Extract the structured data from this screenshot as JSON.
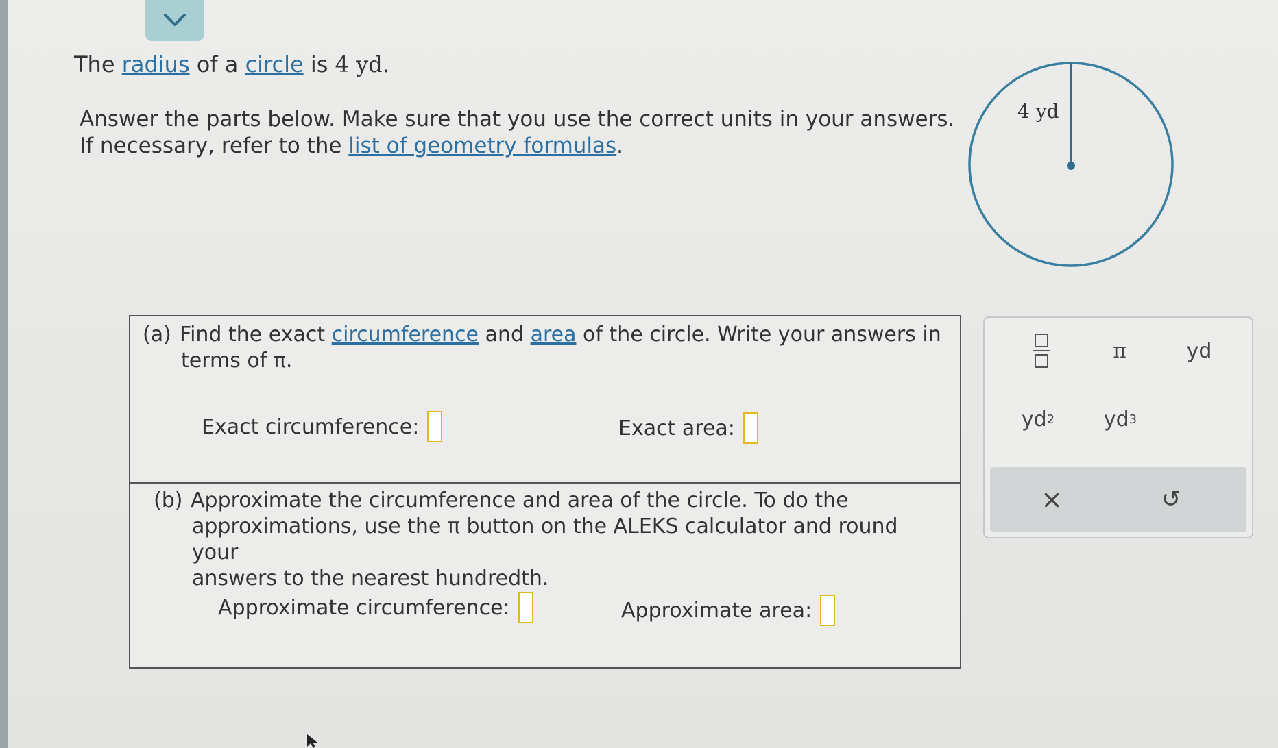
{
  "intro": {
    "prefix": "The",
    "radius_link": "radius",
    "of_a": "of a",
    "circle_link": "circle",
    "is": "is",
    "value": "4 yd."
  },
  "instructions": {
    "line1": "Answer the parts below. Make sure that you use the correct units in your answers.",
    "line2_prefix": "If necessary, refer to the",
    "formulas_link": "list of geometry formulas",
    "line2_suffix": "."
  },
  "figure": {
    "radius_label": "4 yd",
    "colors": {
      "circle": "#3a7fa0",
      "radius": "#2f6f8c"
    }
  },
  "part_a": {
    "label": "(a)",
    "text_find": "Find the exact",
    "circumference_link": "circumference",
    "and": "and",
    "area_link": "area",
    "text_rest": "of the circle. Write your answers in",
    "line2": "terms of π.",
    "exact_circumference_label": "Exact circumference:",
    "exact_area_label": "Exact area:"
  },
  "part_b": {
    "label": "(b)",
    "line1": "Approximate the circumference and area of the circle. To do the",
    "line2": "approximations, use the π button on the ALEKS calculator and round your",
    "line3": "answers to the nearest hundredth.",
    "approx_circumference_label": "Approximate circumference:",
    "approx_area_label": "Approximate area:"
  },
  "keypad": {
    "pi": "π",
    "yd": "yd",
    "yd2_base": "yd",
    "yd2_exp": "2",
    "yd3_base": "yd",
    "yd3_exp": "3",
    "clear": "×",
    "undo": "↺"
  },
  "colors": {
    "link": "#2c6fa3",
    "answer_box_border": "#e2b722",
    "collapse_tab": "#a9cfd2"
  }
}
